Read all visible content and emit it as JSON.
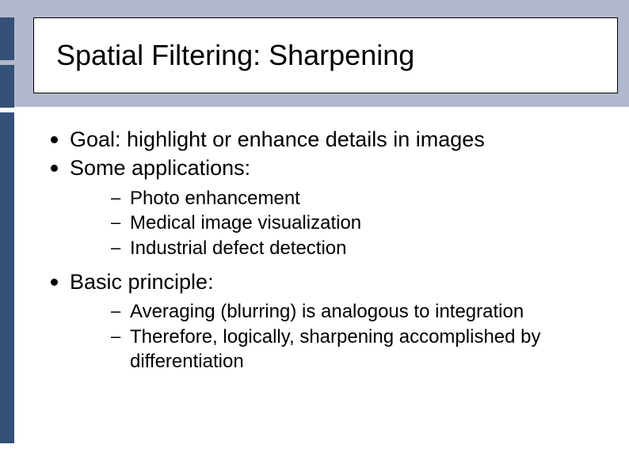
{
  "title": "Spatial Filtering: Sharpening",
  "bullets": [
    {
      "text": "Goal: highlight or enhance details in images"
    },
    {
      "text": "Some applications:",
      "sub": [
        "Photo enhancement",
        "Medical image visualization",
        "Industrial defect detection"
      ]
    },
    {
      "text": "Basic principle:",
      "sub": [
        "Averaging (blurring) is analogous to integration",
        "Therefore, logically, sharpening accomplished by differentiation"
      ]
    }
  ]
}
